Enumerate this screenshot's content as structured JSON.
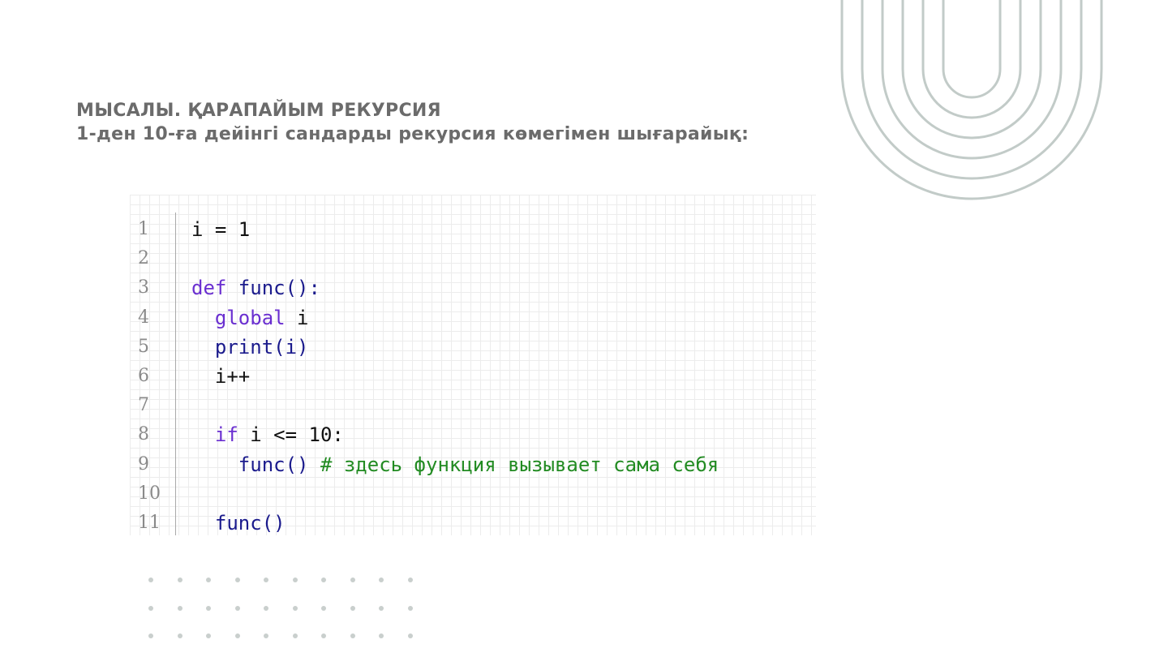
{
  "title": {
    "line1": "МЫСАЛЫ.  ҚАРАПАЙЫМ РЕКУРСИЯ",
    "line2": "1-ден 10-ға дейінгі сандарды рекурсия көмегімен шығарайық:"
  },
  "code": {
    "lines": [
      {
        "num": "1",
        "parts": [
          {
            "text": "i = 1",
            "role": "plain"
          }
        ]
      },
      {
        "num": "2",
        "parts": []
      },
      {
        "num": "3",
        "parts": [
          {
            "text": "def ",
            "role": "kw"
          },
          {
            "text": "func():",
            "role": "fn"
          }
        ]
      },
      {
        "num": "4",
        "parts": [
          {
            "text": "  global ",
            "role": "kw"
          },
          {
            "text": "i",
            "role": "plain"
          }
        ]
      },
      {
        "num": "5",
        "parts": [
          {
            "text": "  print(i)",
            "role": "fn"
          }
        ]
      },
      {
        "num": "6",
        "parts": [
          {
            "text": "  i++",
            "role": "plain"
          }
        ]
      },
      {
        "num": "7",
        "parts": []
      },
      {
        "num": "8",
        "parts": [
          {
            "text": "  if ",
            "role": "kw"
          },
          {
            "text": "i <= 10:",
            "role": "plain"
          }
        ]
      },
      {
        "num": "9",
        "parts": [
          {
            "text": "    func() ",
            "role": "fn"
          },
          {
            "text": "# здесь функция вызывает сама себя",
            "role": "cm"
          }
        ]
      },
      {
        "num": "10",
        "parts": []
      },
      {
        "num": "11",
        "parts": [
          {
            "text": "  func()",
            "role": "fn"
          }
        ]
      }
    ]
  },
  "colors": {
    "title": "#6b6b6b",
    "keyword": "#6a2fd0",
    "function": "#1a1a8c",
    "comment": "#228b22",
    "decor": "#c2cbc8"
  }
}
